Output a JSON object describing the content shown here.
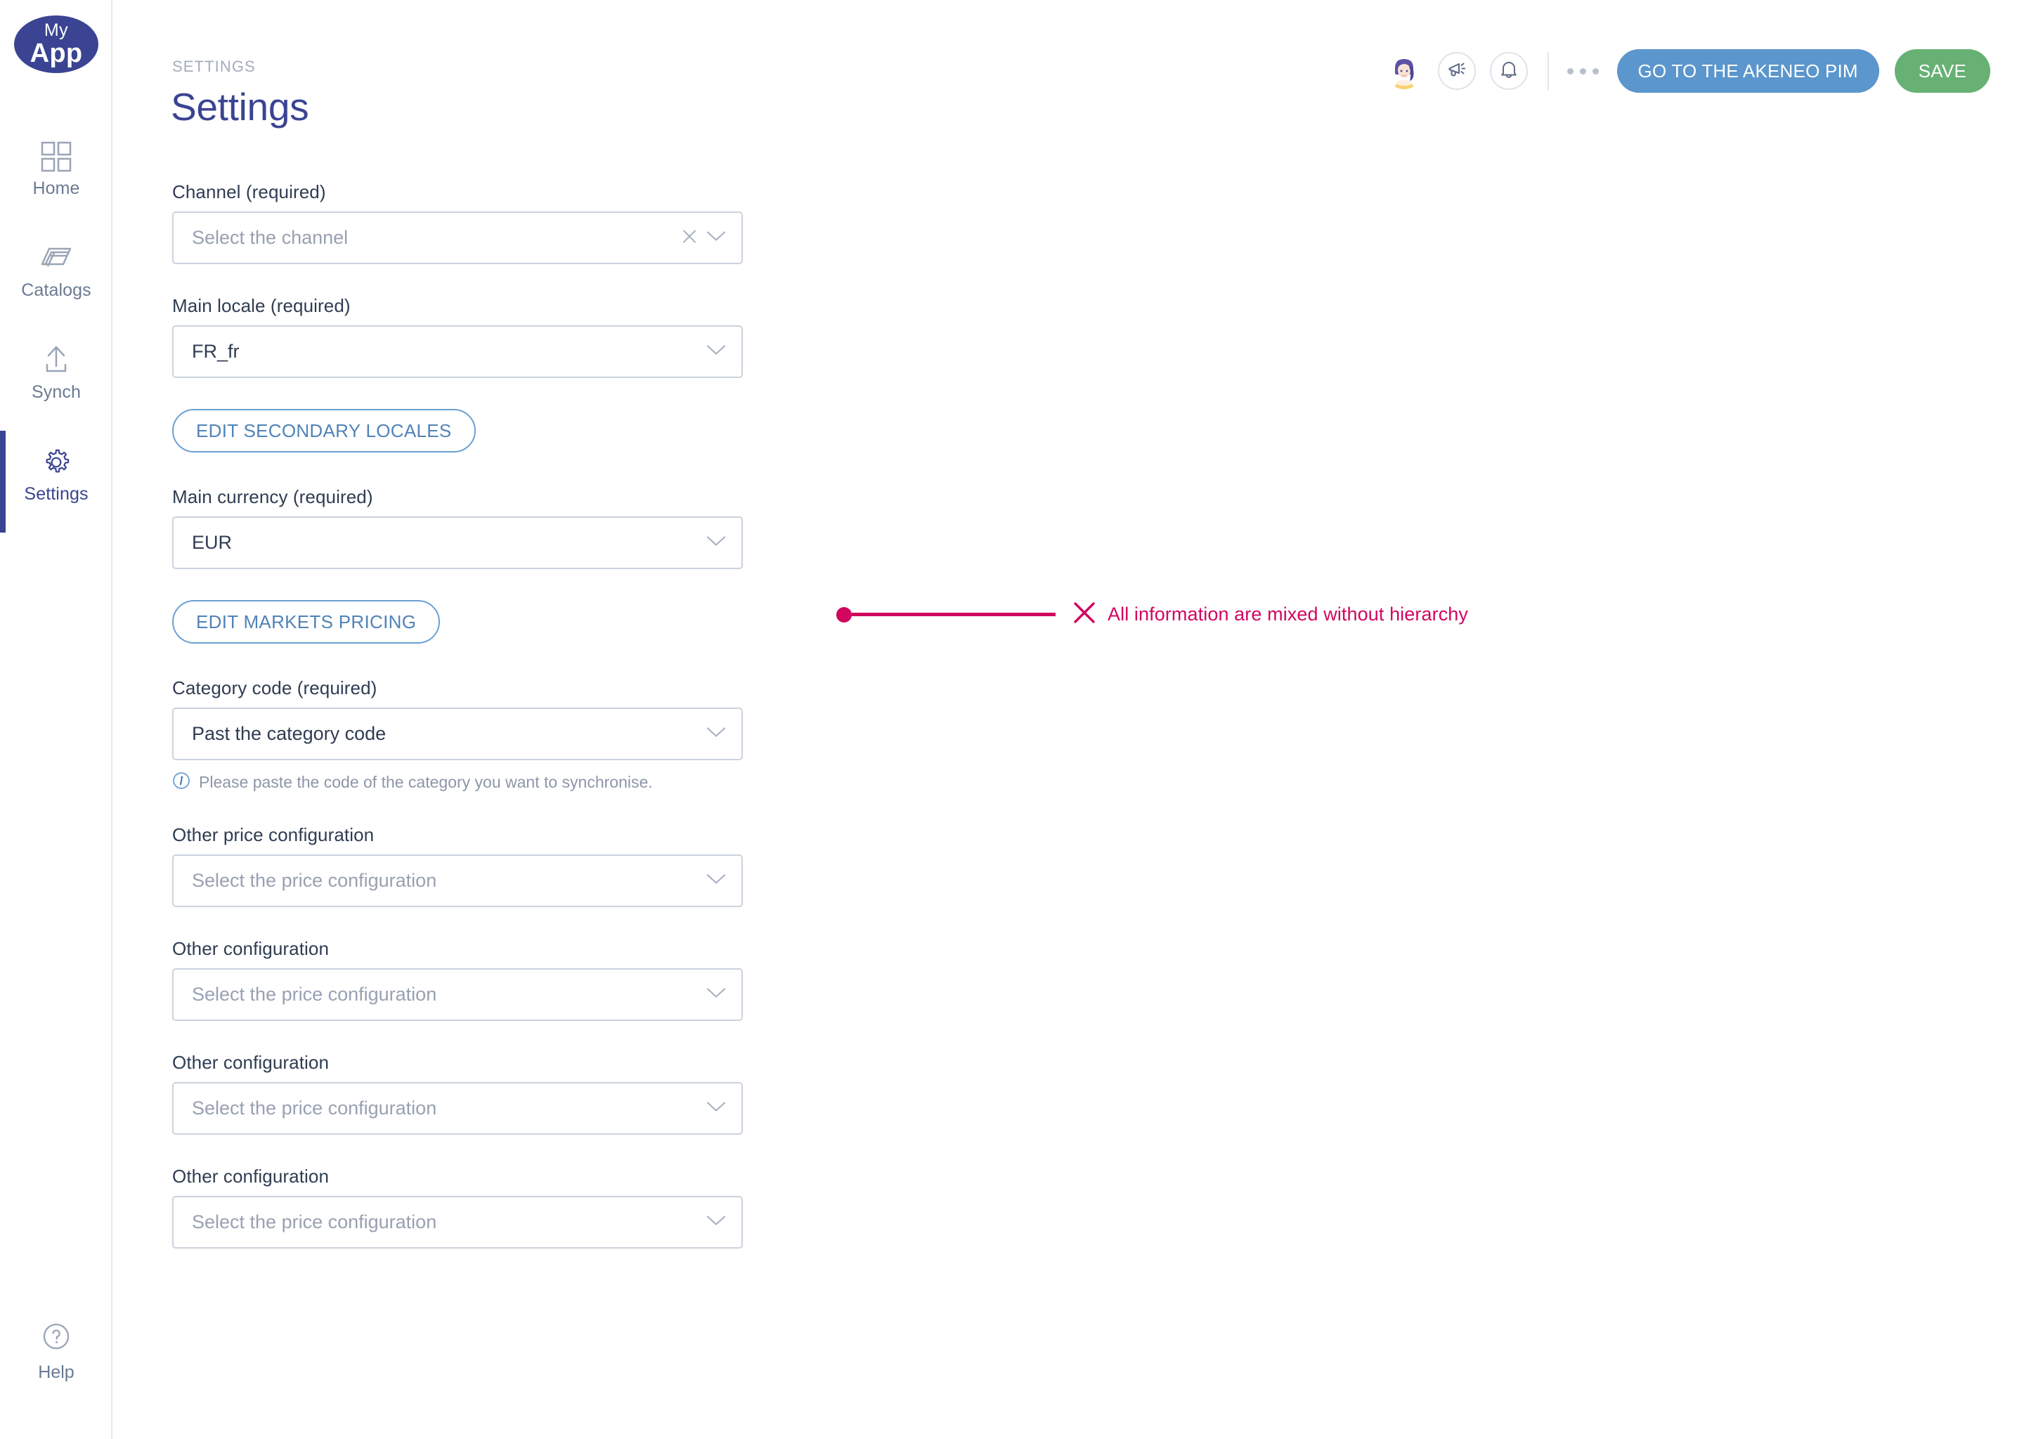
{
  "app": {
    "logo_line1": "My",
    "logo_line2": "App",
    "brand_color": "#3b4492"
  },
  "sidebar": {
    "items": [
      {
        "label": "Home",
        "icon": "grid-icon",
        "active": false
      },
      {
        "label": "Catalogs",
        "icon": "books-icon",
        "active": false
      },
      {
        "label": "Synch",
        "icon": "upload-icon",
        "active": false
      },
      {
        "label": "Settings",
        "icon": "gear-icon",
        "active": true
      }
    ],
    "help": {
      "label": "Help",
      "icon": "question-circle-icon"
    }
  },
  "header": {
    "breadcrumb": "SETTINGS",
    "title": "Settings",
    "avatar": "user-avatar",
    "megaphone_icon": "megaphone-icon",
    "bell_icon": "bell-icon",
    "overflow_icon": "more-dots-icon",
    "pim_button": "GO TO THE AKENEO PIM",
    "save_button": "SAVE",
    "pim_color": "#5b96cd",
    "save_color": "#66b173"
  },
  "form": {
    "fields": [
      {
        "label": "Channel (required)",
        "value": "Select the channel",
        "is_placeholder": true,
        "has_clear": true
      },
      {
        "label": "Main locale (required)",
        "value": "FR_fr",
        "is_placeholder": false,
        "has_clear": false
      },
      {
        "label": "Main currency (required)",
        "value": "EUR",
        "is_placeholder": false,
        "has_clear": false
      },
      {
        "label": "Category code (required)",
        "value": "Past the category code",
        "is_placeholder": false,
        "has_clear": false,
        "helper": "Please paste the code of the category you want to synchronise."
      },
      {
        "label": "Other price configuration",
        "value": "Select the price configuration",
        "is_placeholder": true,
        "has_clear": false
      },
      {
        "label": "Other configuration",
        "value": "Select the price configuration",
        "is_placeholder": true,
        "has_clear": false
      },
      {
        "label": "Other configuration",
        "value": "Select the price configuration",
        "is_placeholder": true,
        "has_clear": false
      },
      {
        "label": "Other configuration",
        "value": "Select the price configuration",
        "is_placeholder": true,
        "has_clear": false
      }
    ],
    "edit_secondary_locales": "EDIT SECONDARY LOCALES",
    "edit_markets_pricing": "EDIT MARKETS PRICING"
  },
  "annotation": {
    "text": "All information are mixed without hierarchy",
    "color": "#d1065f",
    "marker_icon": "cross-icon"
  }
}
